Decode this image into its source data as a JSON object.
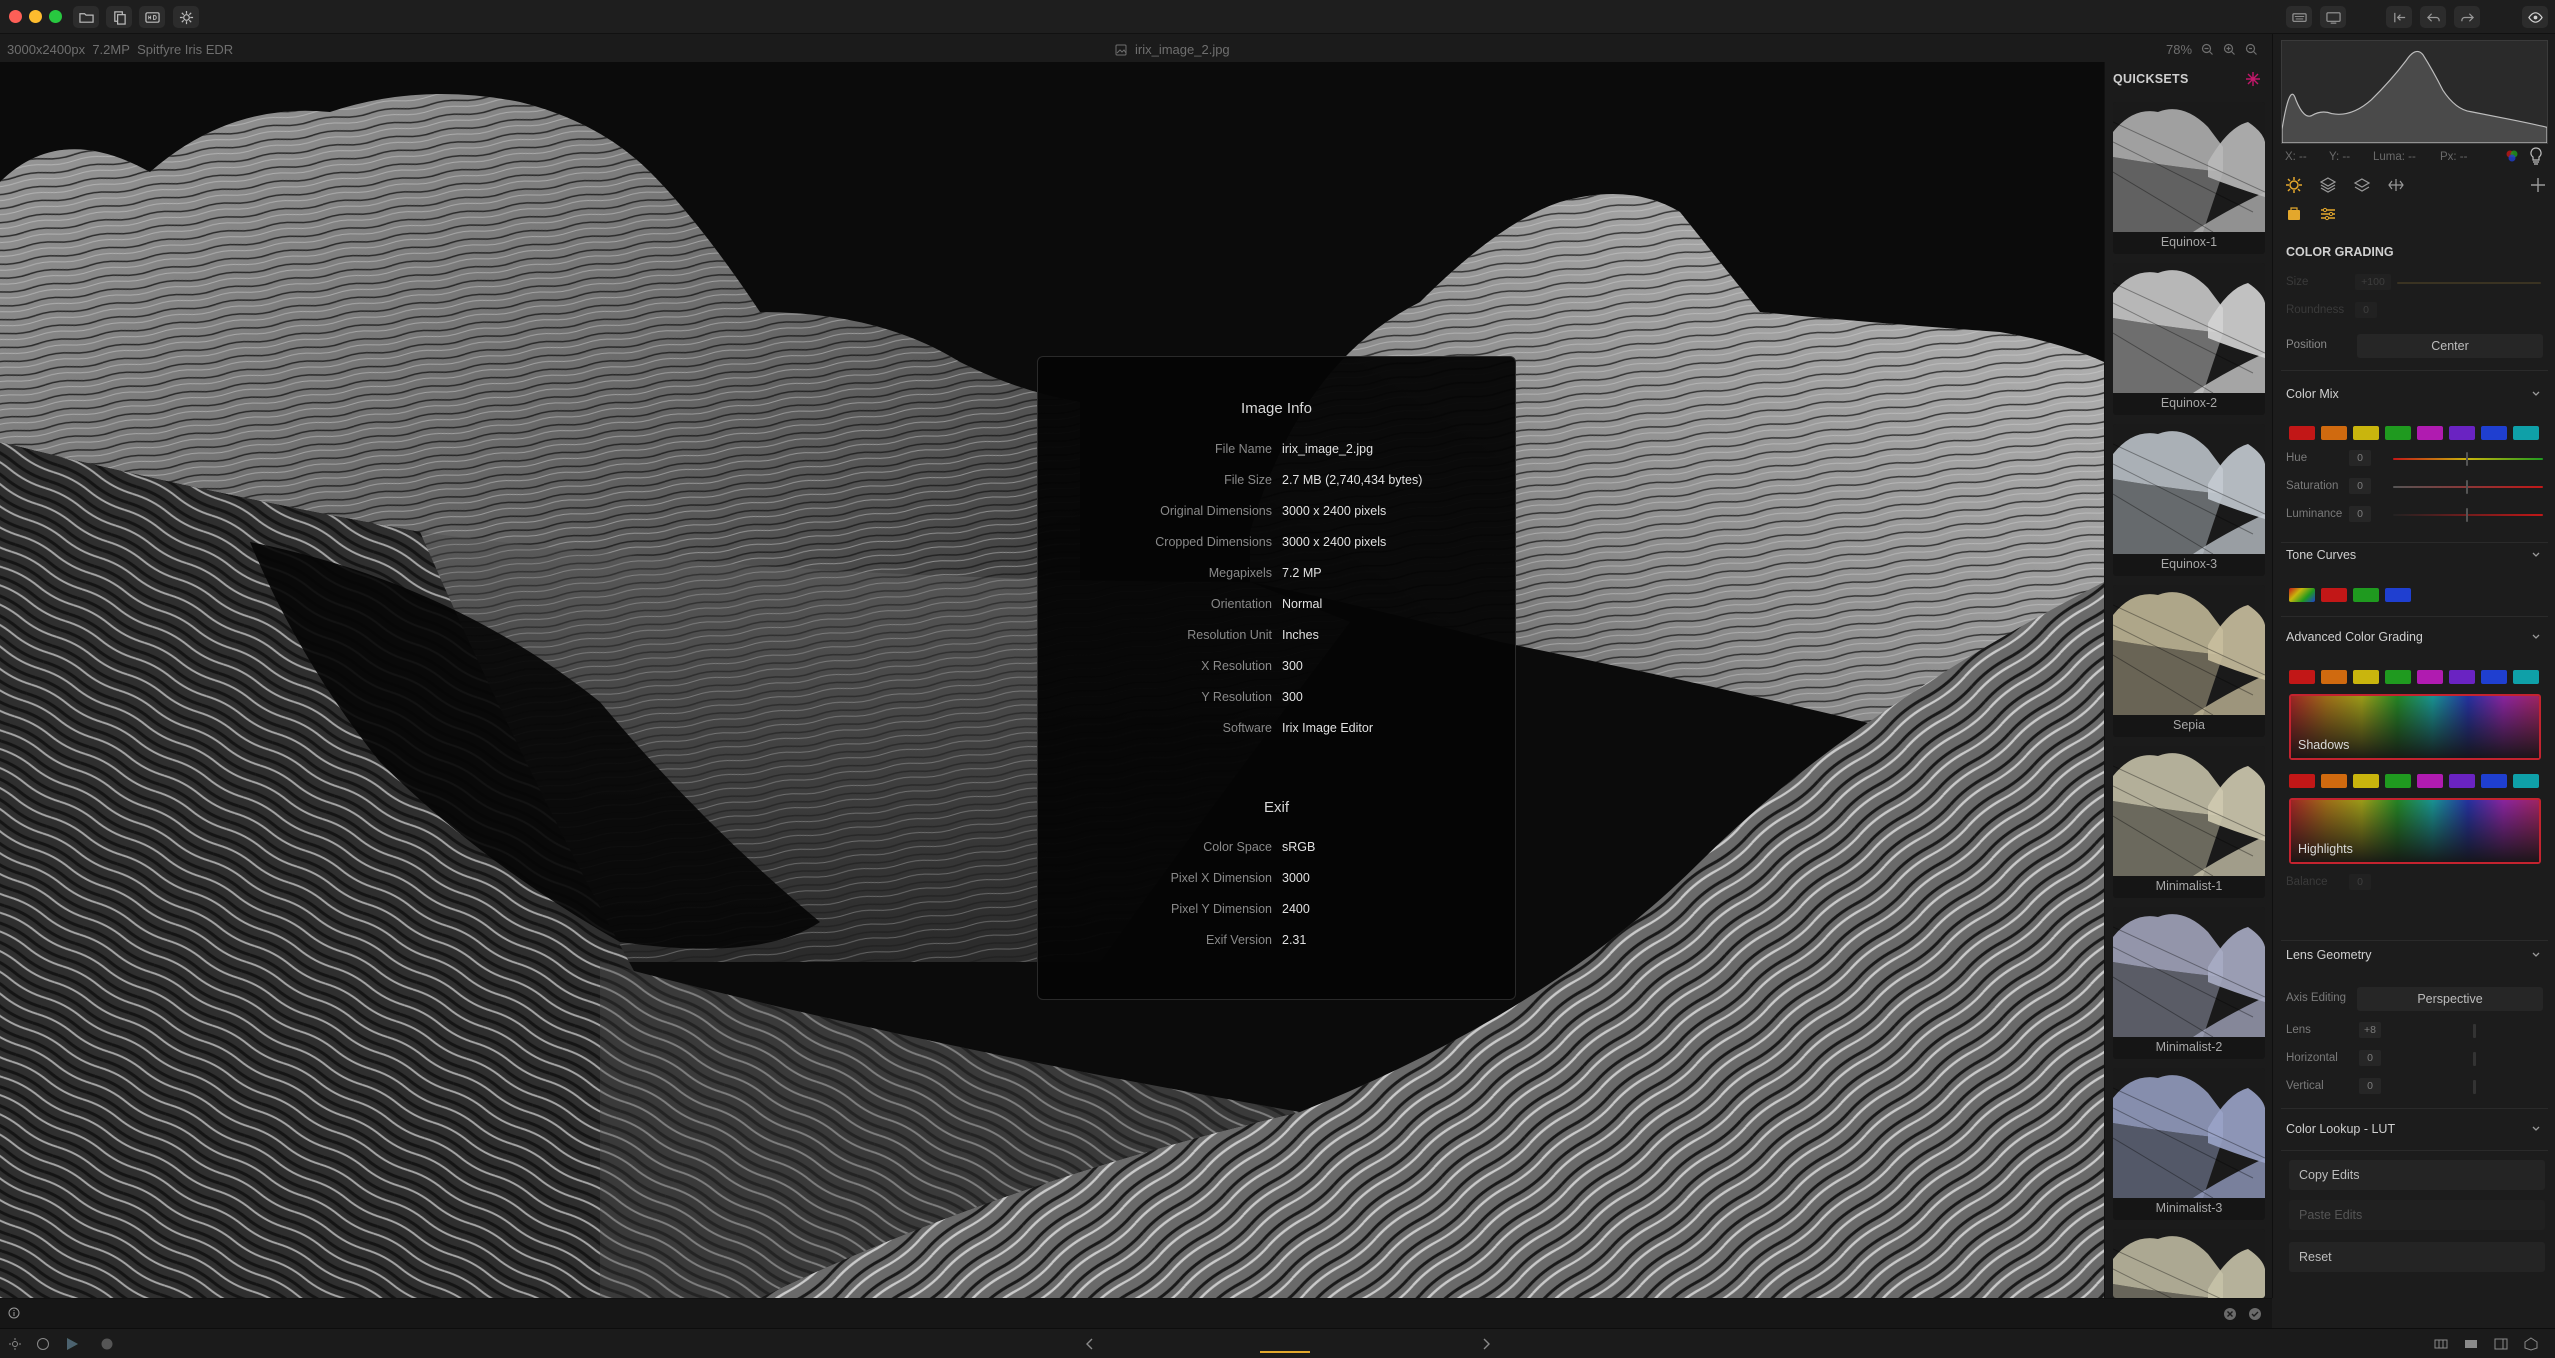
{
  "app": {
    "image_dims": "3000x2400px",
    "megapixels": "7.2MP",
    "display_profile": "Spitfyre Iris EDR",
    "file_name": "irix_image_2.jpg",
    "zoom": "78%"
  },
  "image_info": {
    "title": "Image Info",
    "rows": [
      {
        "label": "File Name",
        "value": "irix_image_2.jpg"
      },
      {
        "label": "File Size",
        "value": "2.7 MB (2,740,434 bytes)"
      },
      {
        "label": "Original Dimensions",
        "value": "3000 x 2400 pixels"
      },
      {
        "label": "Cropped Dimensions",
        "value": "3000 x 2400 pixels"
      },
      {
        "label": "Megapixels",
        "value": "7.2 MP"
      },
      {
        "label": "Orientation",
        "value": "Normal"
      },
      {
        "label": "Resolution Unit",
        "value": "Inches"
      },
      {
        "label": "X Resolution",
        "value": "300"
      },
      {
        "label": "Y Resolution",
        "value": "300"
      },
      {
        "label": "Software",
        "value": "Irix Image Editor"
      }
    ],
    "exif_title": "Exif",
    "exif_rows": [
      {
        "label": "Color Space",
        "value": "sRGB"
      },
      {
        "label": "Pixel X Dimension",
        "value": "3000"
      },
      {
        "label": "Pixel Y Dimension",
        "value": "2400"
      },
      {
        "label": "Exif Version",
        "value": "2.31"
      }
    ]
  },
  "quicksets": {
    "title": "QUICKSETS",
    "items": [
      {
        "label": "Equinox-1",
        "tint": "#b9b9b9"
      },
      {
        "label": "Equinox-2",
        "tint": "#d4d4d4"
      },
      {
        "label": "Equinox-3",
        "tint": "#c4cbd2"
      },
      {
        "label": "Sepia",
        "tint": "#c9bf9e"
      },
      {
        "label": "Minimalist-1",
        "tint": "#cfcab0"
      },
      {
        "label": "Minimalist-2",
        "tint": "#a9acc4"
      },
      {
        "label": "Minimalist-3",
        "tint": "#9aa3c8"
      },
      {
        "label": "",
        "tint": "#c7c2a8"
      }
    ]
  },
  "readout": {
    "x": "X: --",
    "y": "Y: --",
    "luma": "Luma: --",
    "px": "Px: --"
  },
  "panel": {
    "color_grading": {
      "title": "COLOR GRADING",
      "size_label": "Size",
      "size_value": "+100",
      "roundness_label": "Roundness",
      "roundness_value": "0",
      "position_label": "Position",
      "position_value": "Center"
    },
    "color_mix": {
      "title": "Color Mix",
      "hue_label": "Hue",
      "saturation_label": "Saturation",
      "luminance_label": "Luminance",
      "hue_value": "0",
      "saturation_value": "0",
      "luminance_value": "0"
    },
    "tone_curves": {
      "title": "Tone Curves"
    },
    "advanced_color_grading": {
      "title": "Advanced Color Grading",
      "shadows_label": "Shadows",
      "highlights_label": "Highlights",
      "balance_label": "Balance",
      "balance_value": "0"
    },
    "lens_geometry": {
      "title": "Lens Geometry",
      "axis_editing_label": "Axis Editing",
      "axis_editing_value": "Perspective",
      "lens_label": "Lens",
      "lens_value": "+8",
      "horizontal_label": "Horizontal",
      "horizontal_value": "0",
      "vertical_label": "Vertical",
      "vertical_value": "0"
    },
    "color_lookup": {
      "title": "Color Lookup - LUT"
    },
    "actions": {
      "copy": "Copy Edits",
      "paste": "Paste Edits",
      "reset": "Reset"
    }
  },
  "colors": {
    "swatches": [
      "#c21717",
      "#d06a0f",
      "#c9b50d",
      "#1f9a1f",
      "#b01bb0",
      "#6a23c2",
      "#1f3fd0",
      "#0fa0a8"
    ],
    "tone_swatches": [
      "#c9a51f",
      "#c21717",
      "#1f9a1f",
      "#1f3fd0"
    ],
    "accent": "#e3a72c"
  }
}
